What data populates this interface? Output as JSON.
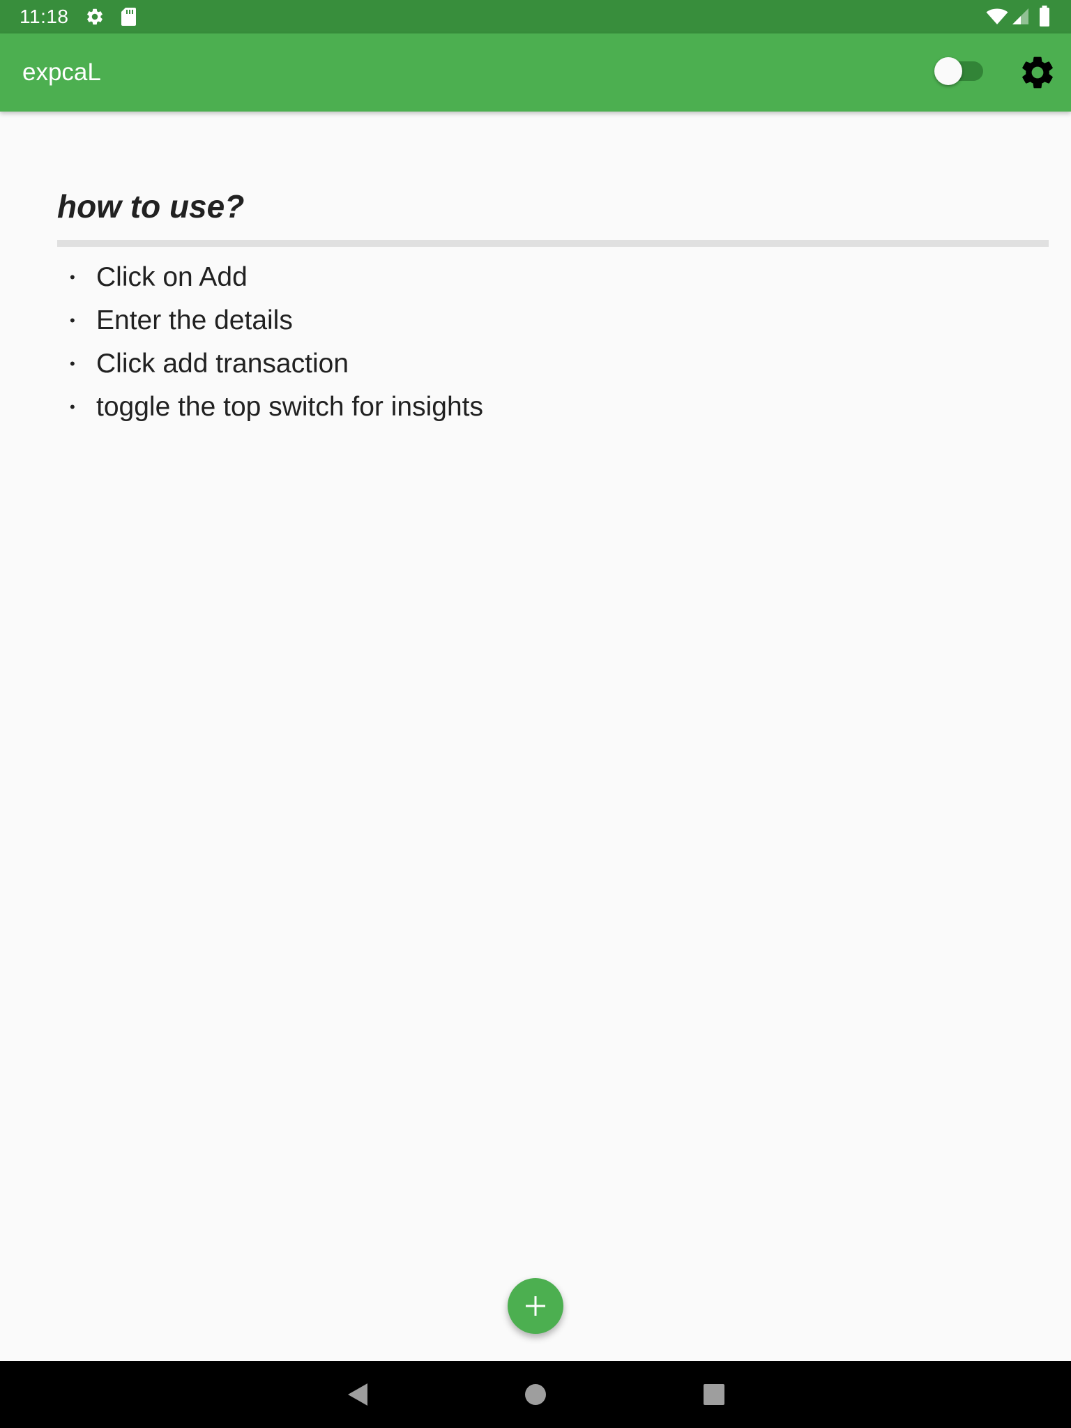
{
  "status_bar": {
    "time": "11:18",
    "icons": [
      "gear-icon",
      "sd-card-icon",
      "wifi-icon",
      "cell-signal-icon",
      "battery-icon"
    ]
  },
  "app_bar": {
    "title": "expcaL",
    "insights_toggle_on": false,
    "settings_icon": "gear-icon"
  },
  "help": {
    "title": "how to use?",
    "bullet": "•",
    "steps": [
      "Click on Add",
      "Enter the details",
      "Click add transaction",
      "toggle the top switch for insights"
    ]
  },
  "fab": {
    "icon": "plus-icon"
  },
  "nav_bar": {
    "buttons": [
      "back-icon",
      "home-icon",
      "recents-icon"
    ]
  },
  "colors": {
    "status_bar": "#388e3c",
    "app_bar": "#4caf50",
    "accent": "#4caf50",
    "background": "#fafafa",
    "text": "#212121",
    "divider": "#e0e0e0",
    "nav_bar": "#000000"
  }
}
